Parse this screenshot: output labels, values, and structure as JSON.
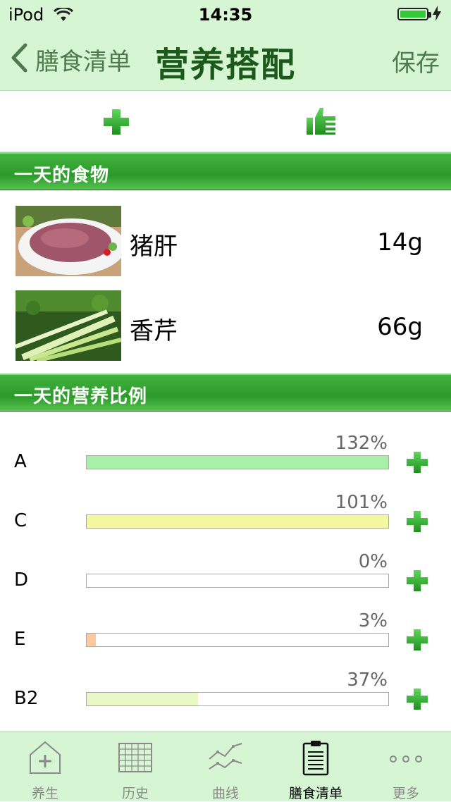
{
  "status": {
    "carrier": "iPod",
    "time": "14:35"
  },
  "nav": {
    "back_label": "膳食清单",
    "title": "营养搭配",
    "save_label": "保存"
  },
  "toolbar": {
    "add_icon": "plus-icon",
    "recommend_icon": "thumbs-up-icon"
  },
  "foods_section": {
    "title": "一天的食物"
  },
  "foods": [
    {
      "name": "猪肝",
      "amount": "14g",
      "image": "pork-liver-photo"
    },
    {
      "name": "香芹",
      "amount": "66g",
      "image": "celery-photo"
    }
  ],
  "nutrition_section": {
    "title": "一天的营养比例"
  },
  "nutrients": [
    {
      "label": "A",
      "percent_text": "132%",
      "percent": 132,
      "color": "#a6f0a8"
    },
    {
      "label": "C",
      "percent_text": "101%",
      "percent": 101,
      "color": "#f3f8a0"
    },
    {
      "label": "D",
      "percent_text": "0%",
      "percent": 0,
      "color": "#ffffff"
    },
    {
      "label": "E",
      "percent_text": "3%",
      "percent": 3,
      "color": "#ffc9a0"
    },
    {
      "label": "B2",
      "percent_text": "37%",
      "percent": 37,
      "color": "#eaf8c6"
    }
  ],
  "tabbar": {
    "items": [
      {
        "label": "养生",
        "icon": "house-plus-icon"
      },
      {
        "label": "历史",
        "icon": "calendar-grid-icon"
      },
      {
        "label": "曲线",
        "icon": "line-chart-icon"
      },
      {
        "label": "膳食清单",
        "icon": "clipboard-icon",
        "active": true
      },
      {
        "label": "更多",
        "icon": "more-dots-icon"
      }
    ]
  }
}
